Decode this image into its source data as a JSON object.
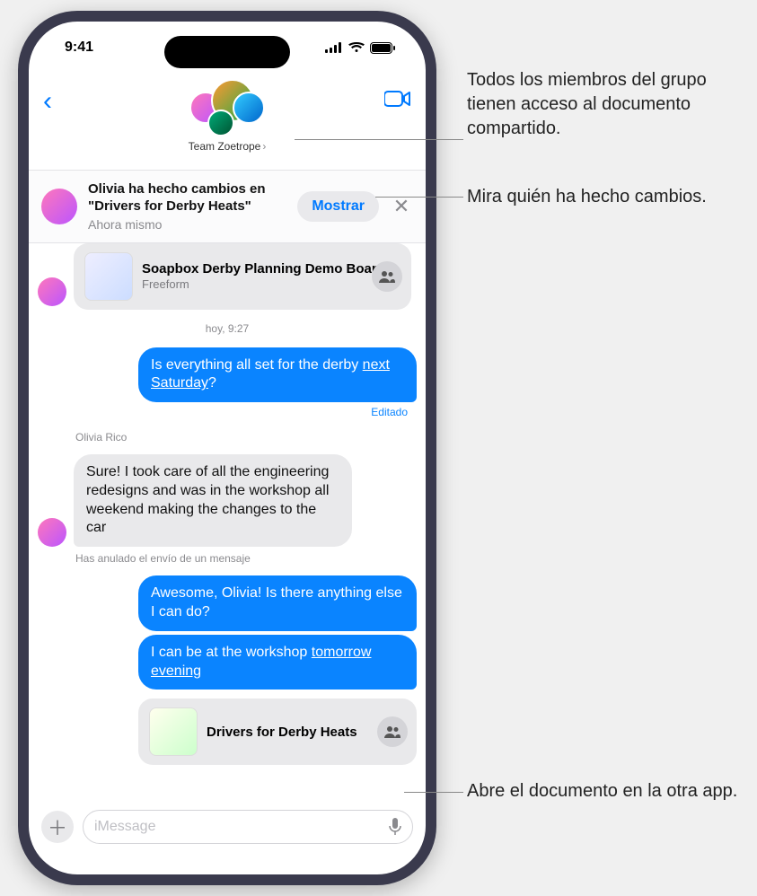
{
  "status": {
    "time": "9:41"
  },
  "header": {
    "group_name": "Team Zoetrope"
  },
  "notice": {
    "title": "Olivia ha hecho cambios en \"Drivers for Derby Heats\"",
    "subtitle": "Ahora mismo",
    "show_label": "Mostrar"
  },
  "attach_top": {
    "title": "Soapbox Derby Planning Demo Board",
    "app": "Freeform"
  },
  "timestamps": {
    "t1": "hoy, 9:27"
  },
  "messages": {
    "m1a": "Is everything all set for the derby ",
    "m1b": "next Saturday",
    "m1c": "?",
    "edited": "Editado",
    "sender_olivia": "Olivia Rico",
    "m2": "Sure! I took care of all the engineering redesigns and was in the workshop all weekend making the changes to the car",
    "unsent": "Has anulado el envío de un mensaje",
    "m3": "Awesome, Olivia! Is there anything else I can do?",
    "m4a": "I can be at the workshop ",
    "m4b": "tomorrow evening"
  },
  "attach_bottom": {
    "title": "Drivers for Derby Heats"
  },
  "compose": {
    "placeholder": "iMessage"
  },
  "callouts": {
    "c1": "Todos los miembros del grupo tienen acceso al documento compartido.",
    "c2": "Mira quién ha hecho cambios.",
    "c3": "Abre el documento en la otra app."
  }
}
